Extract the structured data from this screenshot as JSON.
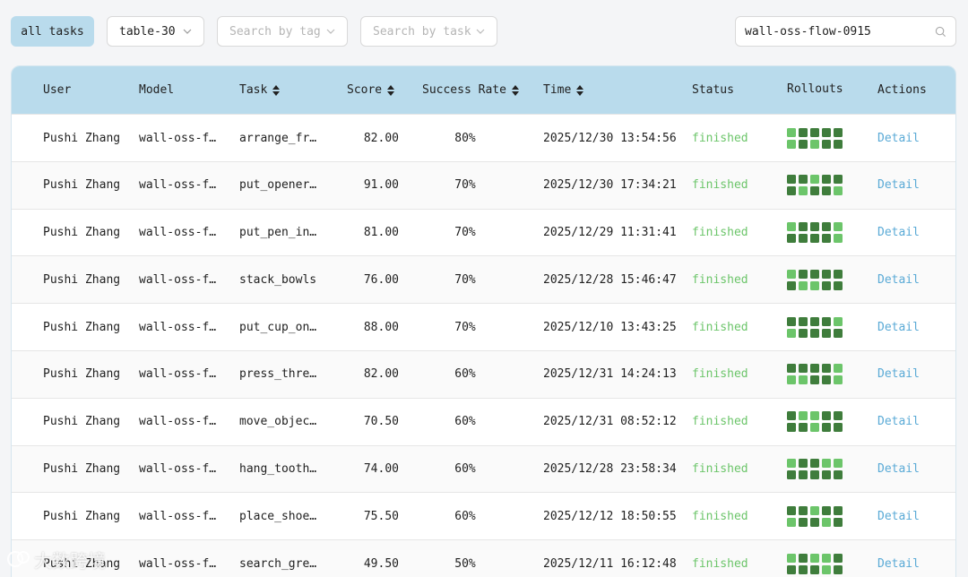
{
  "toolbar": {
    "all_tasks_label": "all tasks",
    "table_select_value": "table-30",
    "tag_select_placeholder": "Search by tag",
    "task_select_placeholder": "Search by task",
    "search_value": "wall-oss-flow-0915"
  },
  "table": {
    "headers": {
      "user": "User",
      "model": "Model",
      "task": "Task",
      "score": "Score",
      "success_rate": "Success Rate",
      "time": "Time",
      "status": "Status",
      "rollouts": "Rollouts",
      "actions": "Actions"
    },
    "rows": [
      {
        "user": "Pushi Zhang",
        "model": "wall-oss-fl…",
        "task": "arrange_fru…",
        "score": "82.00",
        "rate": "80%",
        "time": "2025/12/30 13:54:56",
        "status": "finished",
        "action": "Detail",
        "rollouts": [
          1,
          0,
          0,
          0,
          0,
          1,
          0,
          1,
          0,
          0
        ]
      },
      {
        "user": "Pushi Zhang",
        "model": "wall-oss-fl…",
        "task": "put_opener_…",
        "score": "91.00",
        "rate": "70%",
        "time": "2025/12/30 17:34:21",
        "status": "finished",
        "action": "Detail",
        "rollouts": [
          0,
          0,
          1,
          0,
          0,
          0,
          1,
          0,
          0,
          1
        ]
      },
      {
        "user": "Pushi Zhang",
        "model": "wall-oss-fl…",
        "task": "put_pen_int…",
        "score": "81.00",
        "rate": "70%",
        "time": "2025/12/29 11:31:41",
        "status": "finished",
        "action": "Detail",
        "rollouts": [
          1,
          0,
          0,
          0,
          1,
          0,
          0,
          0,
          0,
          1
        ]
      },
      {
        "user": "Pushi Zhang",
        "model": "wall-oss-fl…",
        "task": "stack_bowls",
        "score": "76.00",
        "rate": "70%",
        "time": "2025/12/28 15:46:47",
        "status": "finished",
        "action": "Detail",
        "rollouts": [
          1,
          0,
          0,
          0,
          0,
          0,
          1,
          1,
          0,
          0
        ]
      },
      {
        "user": "Pushi Zhang",
        "model": "wall-oss-fl…",
        "task": "put_cup_on_…",
        "score": "88.00",
        "rate": "70%",
        "time": "2025/12/10 13:43:25",
        "status": "finished",
        "action": "Detail",
        "rollouts": [
          0,
          0,
          0,
          0,
          1,
          1,
          0,
          0,
          0,
          0
        ]
      },
      {
        "user": "Pushi Zhang",
        "model": "wall-oss-fl…",
        "task": "press_three…",
        "score": "82.00",
        "rate": "60%",
        "time": "2025/12/31 14:24:13",
        "status": "finished",
        "action": "Detail",
        "rollouts": [
          0,
          0,
          0,
          0,
          1,
          1,
          1,
          0,
          0,
          1
        ]
      },
      {
        "user": "Pushi Zhang",
        "model": "wall-oss-fl…",
        "task": "move_object…",
        "score": "70.50",
        "rate": "60%",
        "time": "2025/12/31 08:52:12",
        "status": "finished",
        "action": "Detail",
        "rollouts": [
          0,
          1,
          1,
          0,
          0,
          0,
          0,
          1,
          0,
          0
        ]
      },
      {
        "user": "Pushi Zhang",
        "model": "wall-oss-fl…",
        "task": "hang_toothb…",
        "score": "74.00",
        "rate": "60%",
        "time": "2025/12/28 23:58:34",
        "status": "finished",
        "action": "Detail",
        "rollouts": [
          1,
          0,
          0,
          1,
          1,
          0,
          0,
          0,
          0,
          0
        ]
      },
      {
        "user": "Pushi Zhang",
        "model": "wall-oss-fl…",
        "task": "place_shoes…",
        "score": "75.50",
        "rate": "60%",
        "time": "2025/12/12 18:50:55",
        "status": "finished",
        "action": "Detail",
        "rollouts": [
          0,
          0,
          1,
          0,
          0,
          1,
          0,
          0,
          1,
          0
        ]
      },
      {
        "user": "Pushi Zhang",
        "model": "wall-oss-fl…",
        "task": "search_gree…",
        "score": "49.50",
        "rate": "50%",
        "time": "2025/12/11 16:12:48",
        "status": "finished",
        "action": "Detail",
        "rollouts": [
          1,
          0,
          1,
          1,
          0,
          0,
          0,
          0,
          1,
          0
        ]
      }
    ]
  },
  "colors": {
    "header_bg": "#b9dbec",
    "rollout_success": "#6cc56a",
    "rollout_fail": "#3f7d3c",
    "status_finished": "#6cc56a",
    "link": "#5aaad6"
  },
  "watermark": "大数跨境"
}
